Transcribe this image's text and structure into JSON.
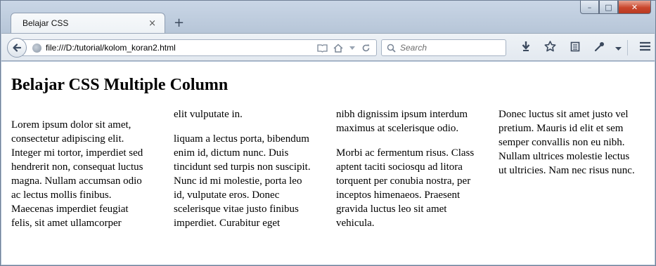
{
  "window": {
    "caption": {
      "minimize": "–",
      "maximize": "□",
      "close": "✕"
    }
  },
  "tabs": [
    {
      "title": "Belajar CSS",
      "close": "×"
    }
  ],
  "new_tab": "+",
  "navbar": {
    "back_icon": "arrow-left-icon",
    "url": "file:///D:/tutorial/kolom_koran2.html",
    "search_placeholder": "Search"
  },
  "page": {
    "heading": "Belajar CSS Multiple Column",
    "columns": [
      {
        "paragraphs": [
          "Lorem ipsum dolor sit amet, consectetur adipiscing elit. Integer mi tortor, imperdiet sed hendrerit non, consequat luctus magna. Nullam accumsan odio ac lectus mollis finibus. Maecenas imperdiet feugiat felis, sit amet ullamcorper"
        ]
      },
      {
        "paragraphs": [
          "elit vulputate in.",
          "liquam a lectus porta, bibendum enim id, dictum nunc. Duis tincidunt sed turpis non suscipit. Nunc id mi molestie, porta leo id, vulputate eros. Donec scelerisque vitae justo finibus imperdiet. Curabitur eget"
        ]
      },
      {
        "paragraphs": [
          "nibh dignissim ipsum interdum maximus at scelerisque odio.",
          "Morbi ac fermentum risus. Class aptent taciti sociosqu ad litora torquent per conubia nostra, per inceptos himenaeos. Praesent gravida luctus leo sit amet vehicula."
        ]
      },
      {
        "paragraphs": [
          "Donec luctus sit amet justo vel pretium. Mauris id elit et sem semper convallis non eu nibh. Nullam ultrices molestie lectus ut ultricies. Nam nec risus nunc."
        ]
      }
    ]
  }
}
